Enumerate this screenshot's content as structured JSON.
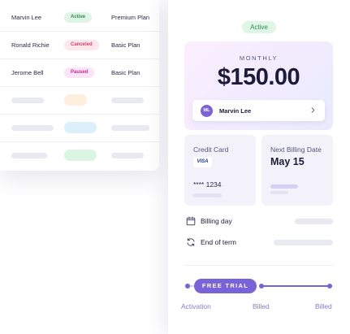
{
  "table": {
    "rows": [
      {
        "name": "Marvin Lee",
        "status": "Active",
        "plan": "Premium Plan"
      },
      {
        "name": "Ronald Richie",
        "status": "Canceled",
        "plan": "Basic Plan"
      },
      {
        "name": "Jerome Bell",
        "status": "Paused",
        "plan": "Basic Plan"
      }
    ]
  },
  "subscription": {
    "status": "Active",
    "period_label": "MONTHLY",
    "price": "$150.00",
    "customer": {
      "initials": "ML",
      "name": "Marvin Lee"
    },
    "payment": {
      "title": "Credit Card",
      "brand": "VISA",
      "number": "**** 1234"
    },
    "next_billing": {
      "title": "Next Billing Date",
      "date": "May 15"
    },
    "details": {
      "billing_day": "Billing day",
      "end_of_term": "End of term"
    },
    "timeline": {
      "pill": "FREE TRIAL",
      "labels": [
        "Activation",
        "Billed",
        "Billed"
      ]
    }
  },
  "colors": {
    "accent": "#7a62d8",
    "active": "#2e8b55",
    "canceled": "#d0436a",
    "paused": "#c02b9a"
  }
}
